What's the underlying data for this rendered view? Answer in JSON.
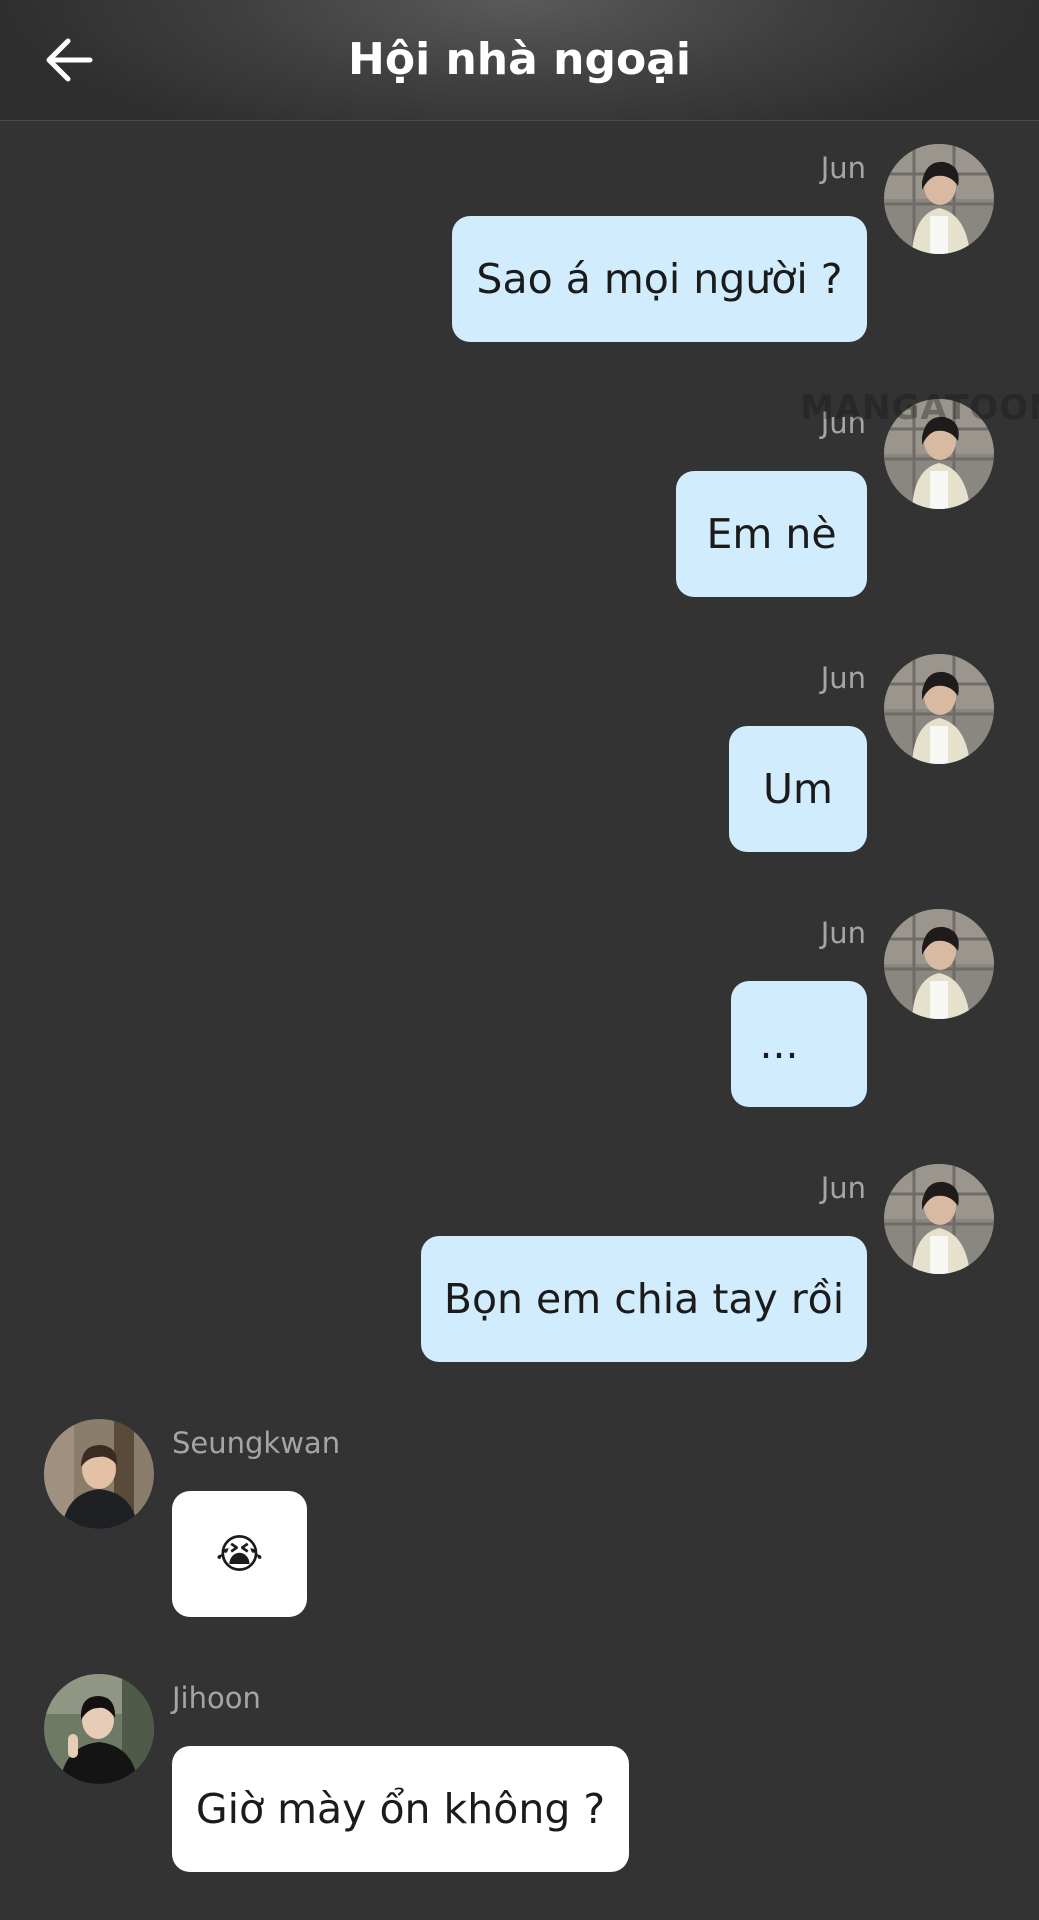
{
  "header": {
    "title": "Hội nhà ngoại"
  },
  "watermark": "MANGATOON",
  "messages": [
    {
      "sender": "Jun",
      "text": "Sao á mọi người ?",
      "side": "right",
      "avatar": "jun-avatar"
    },
    {
      "sender": "Jun",
      "text": "Em nè",
      "side": "right",
      "avatar": "jun-avatar"
    },
    {
      "sender": "Jun",
      "text": "Um",
      "side": "right",
      "avatar": "jun-avatar"
    },
    {
      "sender": "Jun",
      "text": "...",
      "side": "right",
      "avatar": "jun-avatar"
    },
    {
      "sender": "Jun",
      "text": "Bọn em chia tay rồi",
      "side": "right",
      "avatar": "jun-avatar"
    },
    {
      "sender": "Seungkwan",
      "text": "😭",
      "side": "left",
      "avatar": "seungkwan-avatar"
    },
    {
      "sender": "Jihoon",
      "text": "Giờ mày ổn không ?",
      "side": "left",
      "avatar": "jihoon-avatar"
    }
  ],
  "colors": {
    "background": "#333333",
    "outgoing_bubble": "#d1ecfd",
    "incoming_bubble": "#ffffff",
    "sender_name": "#a5a5a5"
  },
  "icons": {
    "back": "arrow-left-icon"
  }
}
